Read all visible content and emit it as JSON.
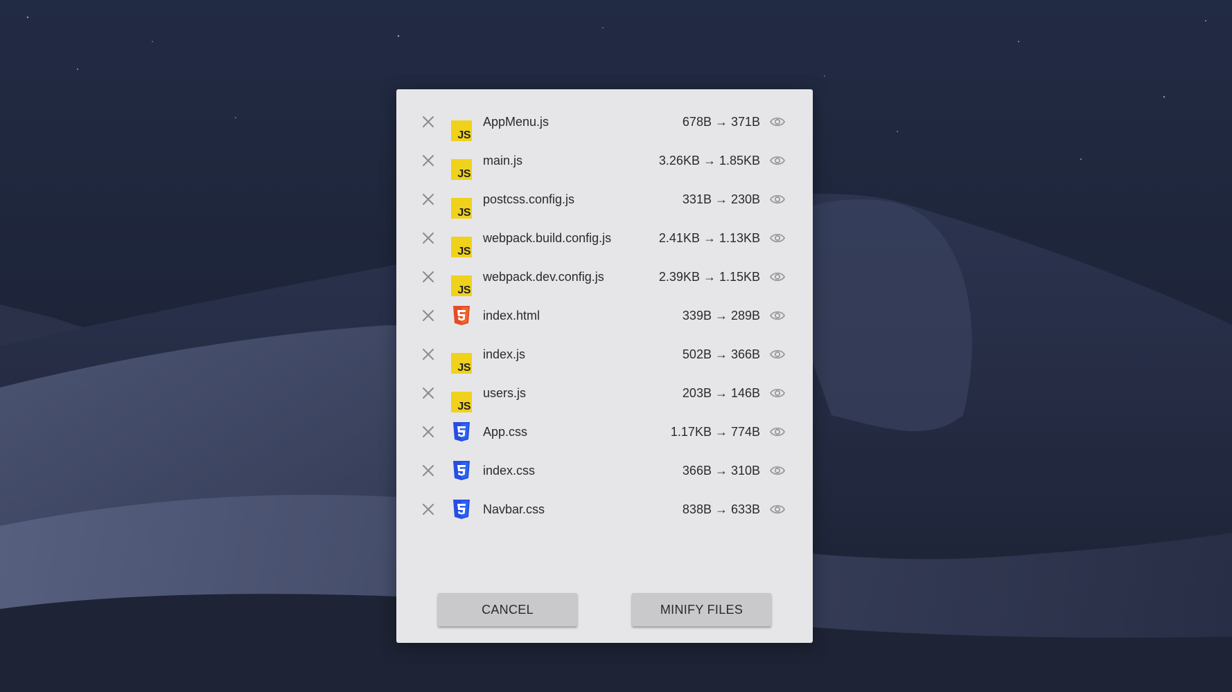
{
  "dialog": {
    "files": [
      {
        "name": "AppMenu.js",
        "size": "678B → 371B",
        "type": "js"
      },
      {
        "name": "main.js",
        "size": "3.26KB → 1.85KB",
        "type": "js"
      },
      {
        "name": "postcss.config.js",
        "size": "331B → 230B",
        "type": "js"
      },
      {
        "name": "webpack.build.config.js",
        "size": "2.41KB → 1.13KB",
        "type": "js"
      },
      {
        "name": "webpack.dev.config.js",
        "size": "2.39KB → 1.15KB",
        "type": "js"
      },
      {
        "name": "index.html",
        "size": "339B → 289B",
        "type": "html"
      },
      {
        "name": "index.js",
        "size": "502B → 366B",
        "type": "js"
      },
      {
        "name": "users.js",
        "size": "203B → 146B",
        "type": "js"
      },
      {
        "name": "App.css",
        "size": "1.17KB → 774B",
        "type": "css"
      },
      {
        "name": "index.css",
        "size": "366B → 310B",
        "type": "css"
      },
      {
        "name": "Navbar.css",
        "size": "838B → 633B",
        "type": "css"
      }
    ],
    "js_icon_text": "JS",
    "cancel_label": "CANCEL",
    "minify_label": "MINIFY FILES"
  },
  "icons": {
    "remove": "close-icon",
    "preview": "eye-icon",
    "js": "js-file-icon",
    "html": "html5-file-icon",
    "css": "css3-file-icon"
  },
  "colors": {
    "dialog_bg": "#e6e6e8",
    "button_bg": "#c9c9cb",
    "js_badge": "#f0d21c",
    "html_badge": "#e34c26",
    "css_badge": "#264de4",
    "muted_icon": "#8a8a8a"
  }
}
